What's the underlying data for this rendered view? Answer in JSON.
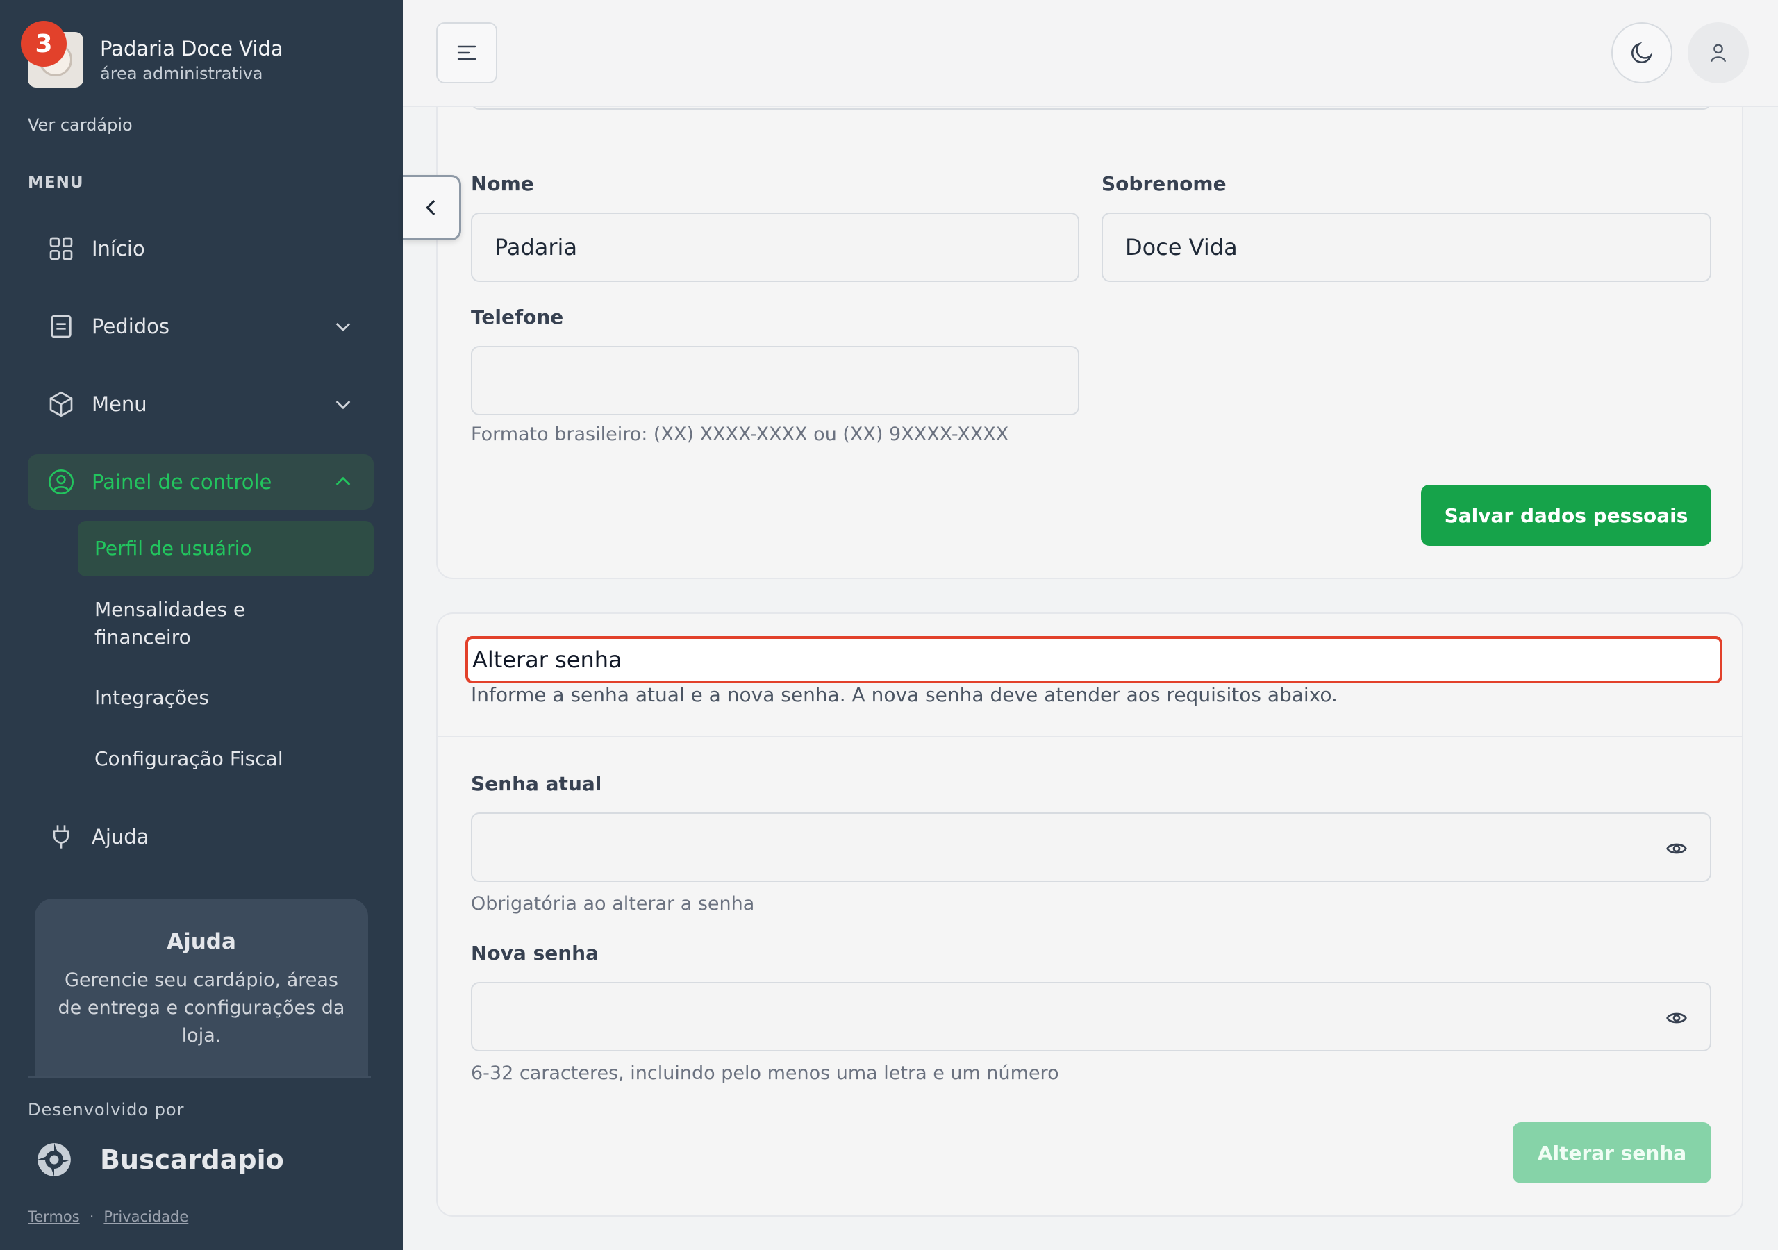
{
  "sidebar": {
    "brand_name": "Padaria Doce Vida",
    "brand_sub": "área administrativa",
    "notification_count": "3",
    "ver_cardapio": "Ver cardápio",
    "menu_label": "MENU",
    "items": {
      "inicio": "Início",
      "pedidos": "Pedidos",
      "menu": "Menu",
      "painel": "Painel de controle",
      "ajuda": "Ajuda"
    },
    "sub_items": {
      "perfil": "Perfil de usuário",
      "mensalidades": "Mensalidades e financeiro",
      "integracoes": "Integrações",
      "fiscal": "Configuração Fiscal"
    },
    "help_card": {
      "title": "Ajuda",
      "desc": "Gerencie seu cardápio, áreas de entrega e configurações da loja."
    },
    "dev_by": "Desenvolvido por",
    "dev_name": "Buscardapio",
    "terms": "Termos",
    "privacy": "Privacidade",
    "accent_color": "#22c55e"
  },
  "personal": {
    "nome_label": "Nome",
    "nome_value": "Padaria",
    "sobrenome_label": "Sobrenome",
    "sobrenome_value": "Doce Vida",
    "telefone_label": "Telefone",
    "telefone_value": "",
    "telefone_hint": "Formato brasileiro: (XX) XXXX-XXXX ou (XX) 9XXXX-XXXX",
    "save_button": "Salvar dados pessoais"
  },
  "password": {
    "title": "Alterar senha",
    "subtitle": "Informe a senha atual e a nova senha. A nova senha deve atender aos requisitos abaixo.",
    "current_label": "Senha atual",
    "current_value": "",
    "current_hint": "Obrigatória ao alterar a senha",
    "new_label": "Nova senha",
    "new_value": "",
    "new_hint": "6-32 caracteres, incluindo pelo menos uma letra e um número",
    "submit_button": "Alterar senha",
    "highlight_color": "#e2412b",
    "button_color": "#16a34a"
  }
}
